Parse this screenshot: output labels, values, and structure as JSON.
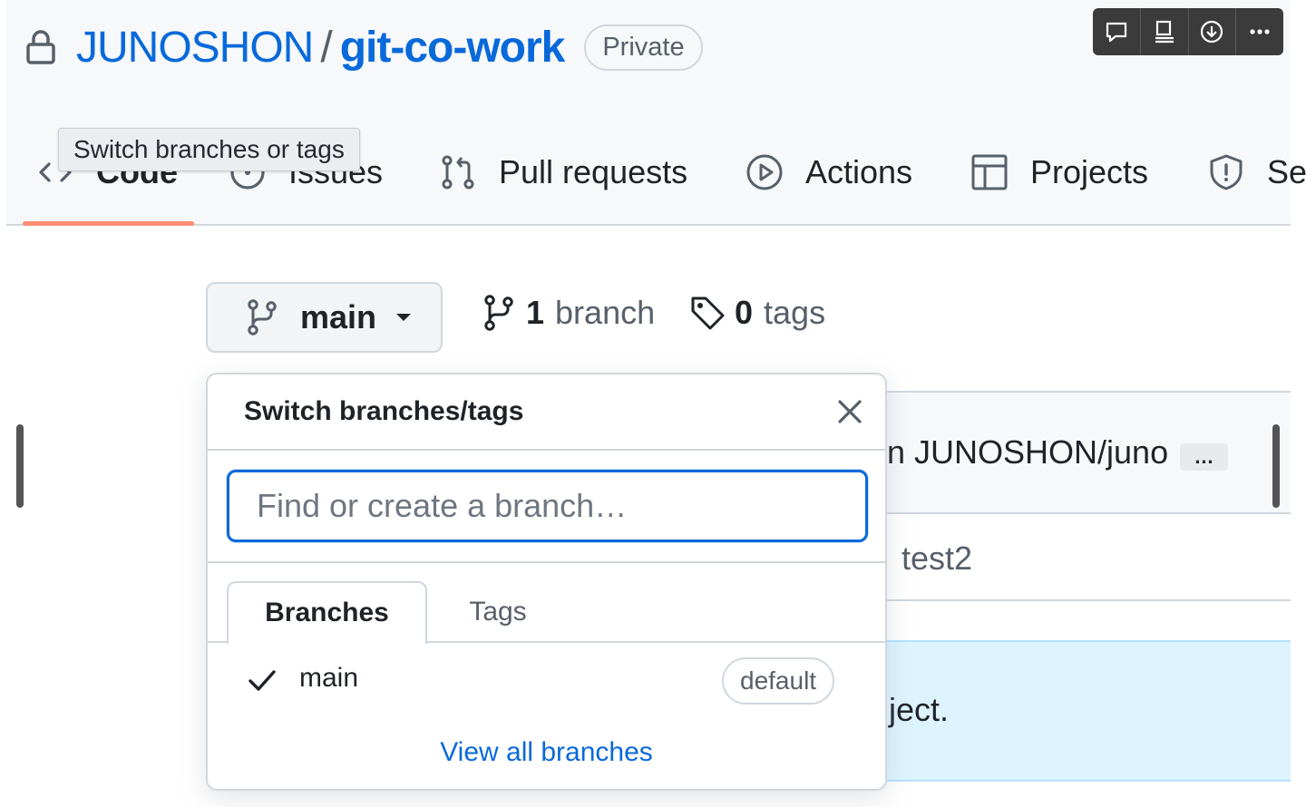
{
  "repo": {
    "owner": "JUNOSHON",
    "separator": "/",
    "name": "git-co-work",
    "visibility": "Private"
  },
  "toolbar": {
    "icons": [
      "comment-icon",
      "screen-icon",
      "download-icon",
      "more-icon"
    ]
  },
  "nav": {
    "tabs": [
      {
        "label": "Code",
        "icon": "code-icon",
        "selected": true
      },
      {
        "label": "Issues",
        "icon": "issue-icon"
      },
      {
        "label": "Pull requests",
        "icon": "pull-request-icon"
      },
      {
        "label": "Actions",
        "icon": "play-icon"
      },
      {
        "label": "Projects",
        "icon": "table-icon"
      },
      {
        "label": "Se",
        "icon": "shield-icon"
      }
    ]
  },
  "tooltip": "Switch branches or tags",
  "branch_button": {
    "label": "main"
  },
  "branch_count": {
    "num": "1",
    "word": "branch"
  },
  "tag_count": {
    "num": "0",
    "word": "tags"
  },
  "background": {
    "commit_text": "n JUNOSHON/juno",
    "commit_ellipsis": "…",
    "file_name": "test2",
    "readme_text": "ject."
  },
  "dropdown": {
    "title": "Switch branches/tags",
    "search_placeholder": "Find or create a branch…",
    "tabs": [
      "Branches",
      "Tags"
    ],
    "items": [
      {
        "label": "main",
        "checked": true,
        "badge": "default"
      }
    ],
    "view_all": "View all branches"
  },
  "colors": {
    "link": "#0969da",
    "underline_accent": "#fd8c73",
    "focus_border": "#0969da",
    "readme_banner": "#ddf4ff"
  }
}
